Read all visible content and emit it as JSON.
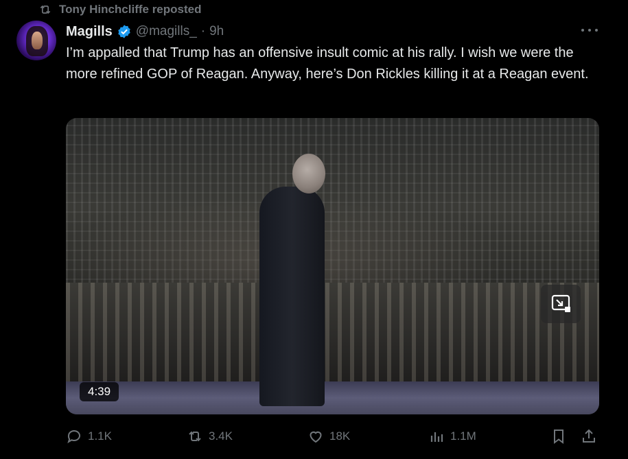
{
  "repost": {
    "text": "Tony Hinchcliffe reposted",
    "icon": "repost-icon"
  },
  "author": {
    "name": "Magills",
    "handle": "@magills_",
    "separator": "·",
    "time": "9h",
    "verified": true
  },
  "tweet": {
    "text": "I’m appalled that Trump has an offensive insult comic at his rally. I wish we were the more refined GOP of Reagan. Anyway, here’s Don Rickles killing it at a Reagan event."
  },
  "media": {
    "duration": "4:39",
    "expand_icon": "expand-icon"
  },
  "actions": {
    "replies": "1.1K",
    "reposts": "3.4K",
    "likes": "18K",
    "views": "1.1M"
  },
  "colors": {
    "accent": "#1d9bf0",
    "muted": "#71767b",
    "text": "#e7e9ea",
    "background": "#000000"
  }
}
